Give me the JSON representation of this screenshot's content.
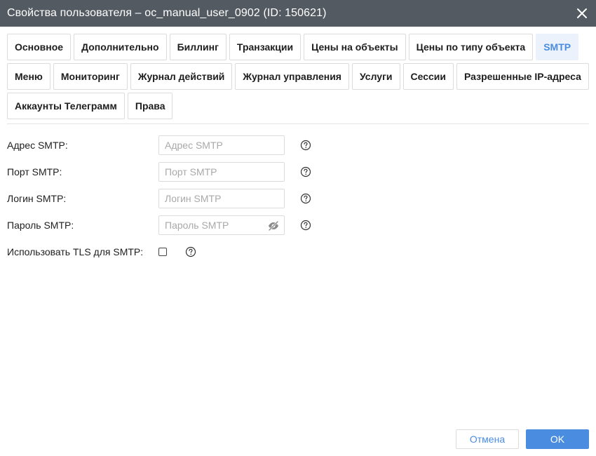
{
  "window": {
    "title": "Свойства пользователя – oc_manual_user_0902 (ID: 150621)"
  },
  "tabs": [
    {
      "label": "Основное",
      "active": false
    },
    {
      "label": "Дополнительно",
      "active": false
    },
    {
      "label": "Биллинг",
      "active": false
    },
    {
      "label": "Транзакции",
      "active": false
    },
    {
      "label": "Цены на объекты",
      "active": false
    },
    {
      "label": "Цены по типу объекта",
      "active": false
    },
    {
      "label": "SMTP",
      "active": true
    },
    {
      "label": "Меню",
      "active": false
    },
    {
      "label": "Мониторинг",
      "active": false
    },
    {
      "label": "Журнал действий",
      "active": false
    },
    {
      "label": "Журнал управления",
      "active": false
    },
    {
      "label": "Услуги",
      "active": false
    },
    {
      "label": "Сессии",
      "active": false
    },
    {
      "label": "Разрешенные IP-адреса",
      "active": false
    },
    {
      "label": "Аккаунты Телеграмм",
      "active": false
    },
    {
      "label": "Права",
      "active": false
    }
  ],
  "form": {
    "smtp_address": {
      "label": "Адрес SMTP:",
      "placeholder": "Адрес SMTP",
      "value": ""
    },
    "smtp_port": {
      "label": "Порт SMTP:",
      "placeholder": "Порт SMTP",
      "value": ""
    },
    "smtp_login": {
      "label": "Логин SMTP:",
      "placeholder": "Логин SMTP",
      "value": ""
    },
    "smtp_password": {
      "label": "Пароль SMTP:",
      "placeholder": "Пароль SMTP",
      "value": ""
    },
    "smtp_tls": {
      "label": "Использовать TLS для SMTP:",
      "checked": false
    }
  },
  "footer": {
    "cancel_label": "Отмена",
    "ok_label": "OK"
  },
  "colors": {
    "titlebar": "#535a61",
    "accent": "#4a8de0",
    "active_tab_bg": "#ebf2fc"
  },
  "icons": {
    "close": "close-icon",
    "help": "help-circle-icon",
    "password_toggle": "eye-off-icon"
  }
}
